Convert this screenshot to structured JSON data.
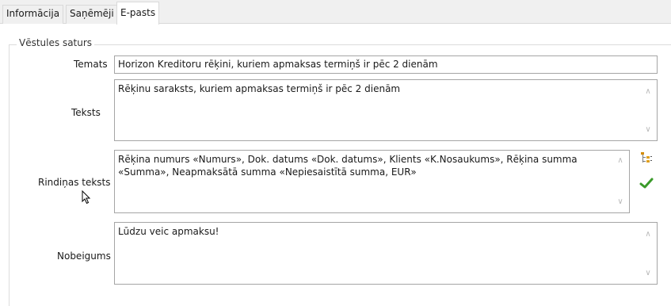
{
  "tabs": [
    {
      "label": "Informācija"
    },
    {
      "label": "Saņēmēji"
    },
    {
      "label": "E-pasts",
      "active": true
    }
  ],
  "group": {
    "legend": "Vēstules saturs"
  },
  "fields": {
    "subject": {
      "label": "Temats",
      "value": "Horizon Kreditoru rēķini, kuriem apmaksas termiņš ir pēc 2 dienām"
    },
    "body": {
      "label": "Teksts",
      "value": "Rēķinu saraksts, kuriem apmaksas termiņš ir pēc 2 dienām"
    },
    "row_text": {
      "label": "Rindiņas teksts",
      "line1": "Rēķina numurs «Numurs», Dok. datums «Dok. datums», Klients «K.Nosaukums», Rēķina summa",
      "line2": "«Summa», Neapmaksātā summa «Nepiesaistītā summa, EUR»"
    },
    "closing": {
      "label": "Nobeigums",
      "value": "Lūdzu veic apmaksu!"
    }
  },
  "icons": {
    "insert_field": "insert-field-icon",
    "validate": "checkmark-icon"
  },
  "colors": {
    "check": "#3a9a2a",
    "insert_field": "#d48b00"
  }
}
